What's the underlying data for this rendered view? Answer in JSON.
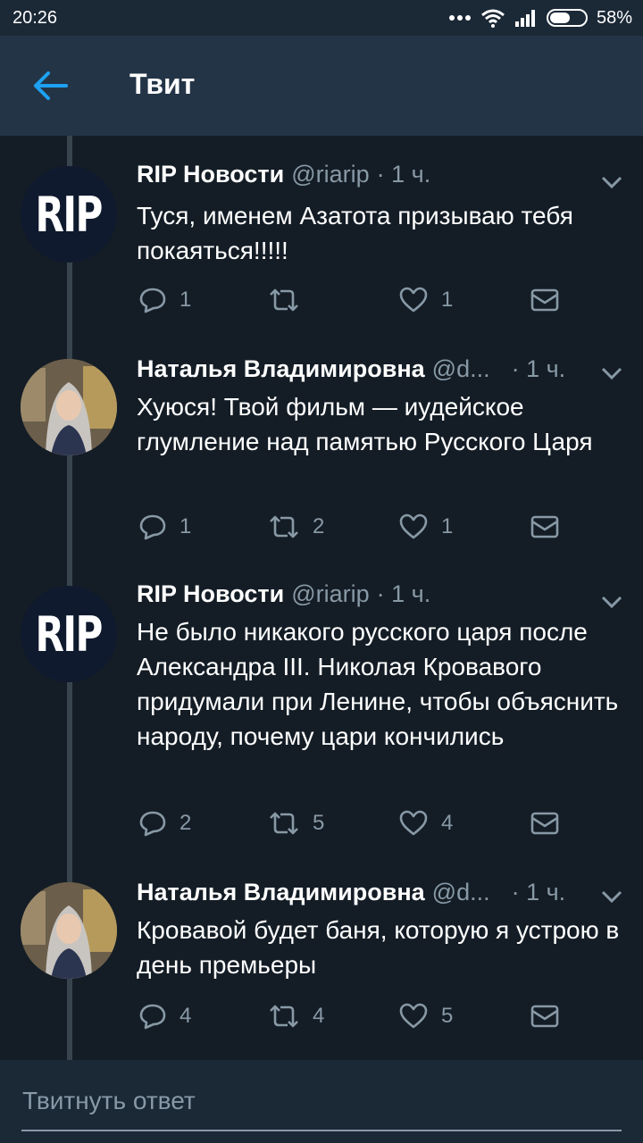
{
  "status_bar": {
    "time": "20:26",
    "battery_text": "58%",
    "battery_level": 0.58,
    "icons": [
      "more-dots-icon",
      "wifi-icon",
      "signal-icon",
      "battery-icon"
    ]
  },
  "header": {
    "title": "Твит",
    "back_icon": "back-arrow-icon"
  },
  "colors": {
    "background": "#141d26",
    "header": "#243447",
    "accent": "#1da1f2",
    "secondary_text": "#8899a6"
  },
  "tweets": [
    {
      "author": "RIP Новости",
      "handle": "@riarip",
      "time": "· 1 ч.",
      "avatar_text": "RIP",
      "text": "Туся, именем Азатота призываю тебя покаяться!!!!!",
      "replies": "1",
      "retweets": "",
      "likes": "1"
    },
    {
      "author": "Наталья Владимировна",
      "handle": "@d...",
      "time": "· 1 ч.",
      "avatar_text": "",
      "text": "Хуюся! Твой фильм — иудейское глумление над памятью Русского Царя",
      "replies": "1",
      "retweets": "2",
      "likes": "1"
    },
    {
      "author": "RIP Новости",
      "handle": "@riarip",
      "time": "· 1 ч.",
      "avatar_text": "RIP",
      "text": "Не было никакого русского царя после Александра III. Николая Кровавого придумали при Ленине, чтобы объяснить народу, почему цари кончились",
      "replies": "2",
      "retweets": "5",
      "likes": "4"
    },
    {
      "author": "Наталья Владимировна",
      "handle": "@d...",
      "time": "· 1 ч.",
      "avatar_text": "",
      "text": "Кровавой будет баня, которую я устрою в день премьеры",
      "replies": "4",
      "retweets": "4",
      "likes": "5"
    }
  ],
  "reply": {
    "placeholder": "Твитнуть ответ",
    "value": ""
  }
}
